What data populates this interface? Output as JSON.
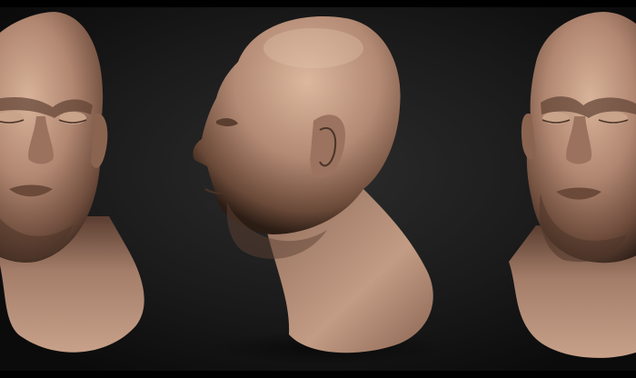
{
  "scene": {
    "subject": "sculpted-head-turnaround",
    "views": [
      {
        "view": "front-left"
      },
      {
        "view": "side-profile"
      },
      {
        "view": "front-right"
      }
    ],
    "colors": {
      "background_center": "#2a2a2a",
      "background_edge": "#0b0b0b",
      "skin_light": "#c9a48a",
      "skin_mid": "#9c7562",
      "skin_dark": "#4a3327",
      "letterbox": "#000000"
    }
  }
}
